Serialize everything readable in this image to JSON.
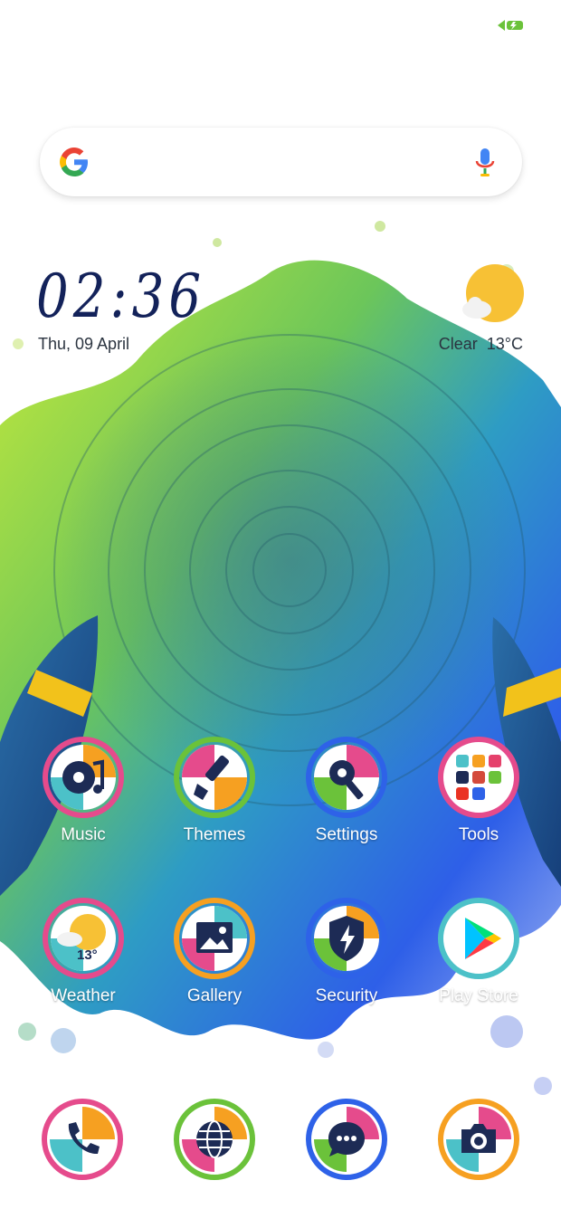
{
  "status_bar": {
    "battery_icon": "battery-charging-icon",
    "accent": "#6bc23a"
  },
  "search": {
    "logo": "google-logo",
    "mic_icon": "microphone-icon"
  },
  "clock": {
    "time": "02:36",
    "date": "Thu, 09 April"
  },
  "weather_widget": {
    "condition": "Clear",
    "temperature": "13°C",
    "icon": "sun-cloud-icon"
  },
  "apps": [
    {
      "label": "Music",
      "icon": "music-disc-icon"
    },
    {
      "label": "Themes",
      "icon": "paintbrush-icon"
    },
    {
      "label": "Settings",
      "icon": "gear-wrench-icon"
    },
    {
      "label": "Tools",
      "icon": "folder-grid-icon"
    },
    {
      "label": "Weather",
      "icon": "weather-sun-icon",
      "badge_temp": "13°"
    },
    {
      "label": "Gallery",
      "icon": "picture-icon"
    },
    {
      "label": "Security",
      "icon": "shield-bolt-icon"
    },
    {
      "label": "Play Store",
      "icon": "play-store-icon"
    }
  ],
  "dock": [
    {
      "name": "phone",
      "icon": "phone-icon"
    },
    {
      "name": "browser",
      "icon": "globe-icon"
    },
    {
      "name": "messages",
      "icon": "chat-bubble-icon"
    },
    {
      "name": "camera",
      "icon": "camera-icon"
    }
  ],
  "colors": {
    "clock": "#13225a",
    "paint_green": "#8ccd2a",
    "paint_blue": "#2e62e8",
    "paint_teal": "#2aa6c8"
  }
}
